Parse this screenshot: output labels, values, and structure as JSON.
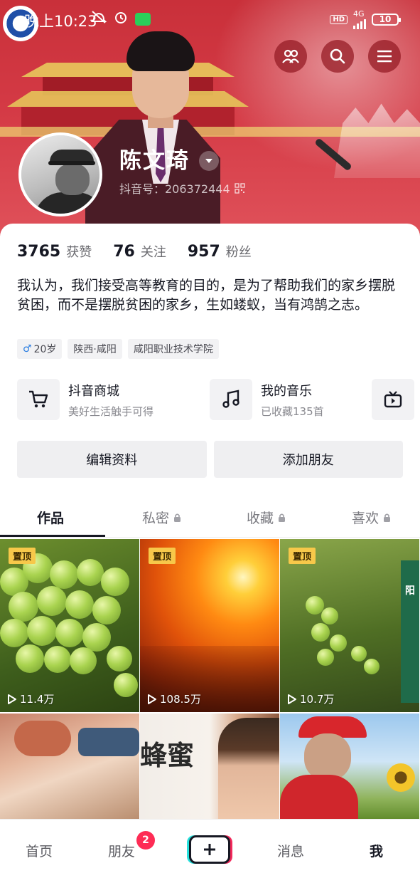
{
  "status_bar": {
    "time": "晚上10:23",
    "network": "4G",
    "hd": "HD",
    "battery": "10"
  },
  "profile": {
    "name": "陈文琦",
    "douyin_id": "抖音号：206372444"
  },
  "stats": [
    {
      "value": "3765",
      "label": "获赞"
    },
    {
      "value": "76",
      "label": "关注"
    },
    {
      "value": "957",
      "label": "粉丝"
    }
  ],
  "bio": "我认为，我们接受高等教育的目的，是为了帮助我们的家乡摆脱贫困，而不是摆脱贫困的家乡，生如蝼蚁，当有鸿鹄之志。",
  "tags": {
    "age": "20岁",
    "location": "陕西·咸阳",
    "school": "咸阳职业技术学院"
  },
  "shortcuts": [
    {
      "title": "抖音商城",
      "subtitle": "美好生活触手可得",
      "icon": "cart-icon"
    },
    {
      "title": "我的音乐",
      "subtitle": "已收藏135首",
      "icon": "music-icon"
    },
    {
      "title": "",
      "subtitle": "",
      "icon": "tv-icon"
    }
  ],
  "actions": {
    "edit_profile": "编辑资料",
    "add_friends": "添加朋友"
  },
  "tabs": [
    {
      "label": "作品",
      "locked": false,
      "active": true
    },
    {
      "label": "私密",
      "locked": true,
      "active": false
    },
    {
      "label": "收藏",
      "locked": true,
      "active": false
    },
    {
      "label": "喜欢",
      "locked": true,
      "active": false
    }
  ],
  "videos": [
    {
      "pinned": "置顶",
      "views": "11.4万"
    },
    {
      "pinned": "置顶",
      "views": "108.5万"
    },
    {
      "pinned": "置顶",
      "views": "10.7万"
    },
    {
      "pinned": "",
      "views": ""
    },
    {
      "pinned": "",
      "views": "",
      "overlay_text": "蜂蜜"
    },
    {
      "pinned": "",
      "views": ""
    }
  ],
  "video3_side_text": "阳",
  "bottom_nav": {
    "home": "首页",
    "friends": "朋友",
    "friends_badge": "2",
    "messages": "消息",
    "me": "我"
  },
  "colors": {
    "accent_red": "#fe2c55",
    "pin_yellow": "#f7c84a",
    "header_red": "#d43a45"
  }
}
